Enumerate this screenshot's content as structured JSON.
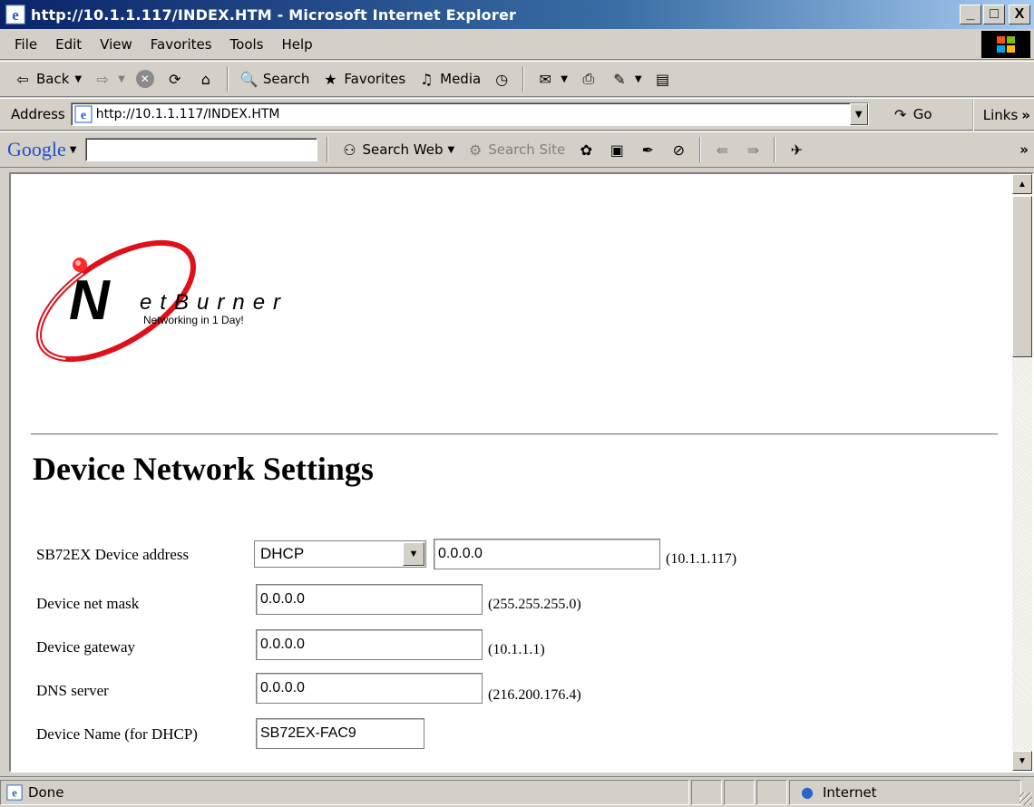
{
  "window": {
    "title": "http://10.1.1.117/INDEX.HTM - Microsoft Internet Explorer",
    "min": "_",
    "max": "□",
    "close": "X"
  },
  "menu": [
    "File",
    "Edit",
    "View",
    "Favorites",
    "Tools",
    "Help"
  ],
  "toolbar": {
    "back": "Back",
    "search": "Search",
    "favorites": "Favorites",
    "media": "Media"
  },
  "address": {
    "label": "Address",
    "url": "http://10.1.1.117/INDEX.HTM",
    "go": "Go",
    "links": "Links"
  },
  "google": {
    "logo": "Google",
    "search_web": "Search Web",
    "search_site": "Search Site",
    "query": ""
  },
  "page": {
    "logo_word": "etBurner",
    "logo_tagline": "Networking in 1 Day!",
    "title": "Device Network Settings",
    "rows": [
      {
        "label": "SB72EX Device address",
        "mode": "DHCP",
        "value": "0.0.0.0",
        "hint": "(10.1.1.117)"
      },
      {
        "label": "Device net mask",
        "value": "0.0.0.0",
        "hint": "(255.255.255.0)"
      },
      {
        "label": "Device gateway",
        "value": "0.0.0.0",
        "hint": "(10.1.1.1)"
      },
      {
        "label": "DNS server",
        "value": "0.0.0.0",
        "hint": "(216.200.176.4)"
      },
      {
        "label": "Device Name (for DHCP)",
        "value": "SB72EX-FAC9"
      }
    ]
  },
  "status": {
    "text": "Done",
    "zone": "Internet"
  },
  "colors": {
    "titlebar_start": "#0a246a",
    "chrome": "#d4d0c8",
    "logo_red": "#e0101a"
  }
}
